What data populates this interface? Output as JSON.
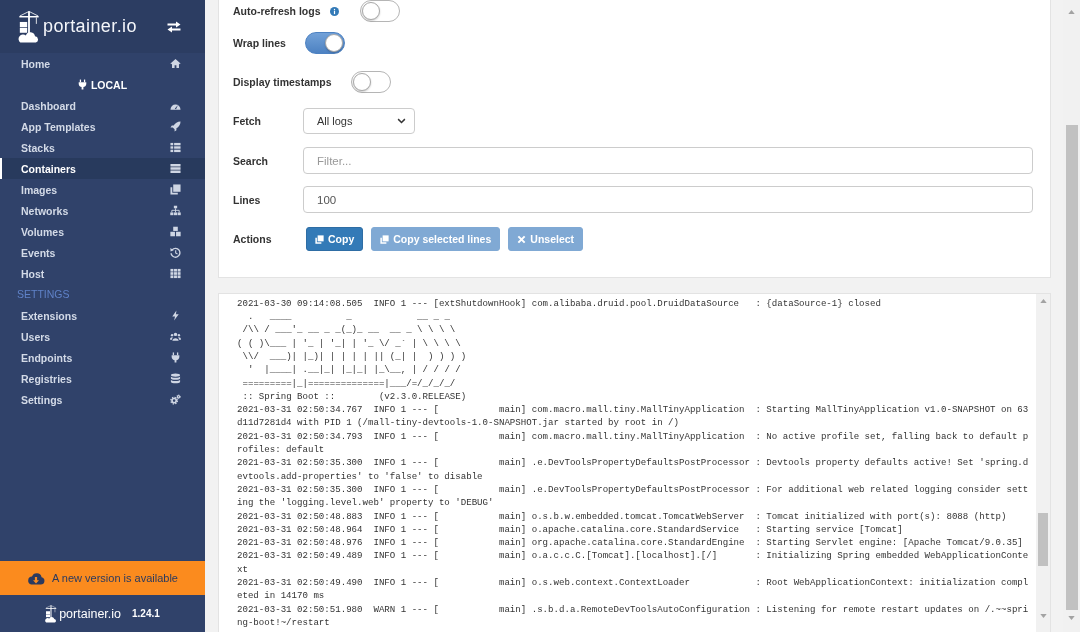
{
  "sidebar": {
    "logo": "portainer.io",
    "items": [
      {
        "label": "Home",
        "selected": false
      }
    ],
    "endpoint": "LOCAL",
    "endpoint_items": [
      {
        "label": "Dashboard",
        "selected": false
      },
      {
        "label": "App Templates",
        "selected": false
      },
      {
        "label": "Stacks",
        "selected": false
      },
      {
        "label": "Containers",
        "selected": true
      },
      {
        "label": "Images",
        "selected": false
      },
      {
        "label": "Networks",
        "selected": false
      },
      {
        "label": "Volumes",
        "selected": false
      },
      {
        "label": "Events",
        "selected": false
      },
      {
        "label": "Host",
        "selected": false
      }
    ],
    "settings_title": "SETTINGS",
    "settings_items": [
      {
        "label": "Extensions",
        "selected": false
      },
      {
        "label": "Users",
        "selected": false
      },
      {
        "label": "Endpoints",
        "selected": false
      },
      {
        "label": "Registries",
        "selected": false
      },
      {
        "label": "Settings",
        "selected": false
      }
    ],
    "update_banner": "A new version is available",
    "footer": {
      "logo": "portainer.io",
      "version": "1.24.1"
    }
  },
  "log_settings": {
    "rows": [
      {
        "kind": "toggle",
        "label": "Auto-refresh logs",
        "info": true,
        "on": false
      },
      {
        "kind": "toggle",
        "label": "Wrap lines",
        "info": false,
        "on": true
      },
      {
        "kind": "toggle",
        "label": "Display timestamps",
        "info": false,
        "on": false
      },
      {
        "kind": "select",
        "label": "Fetch",
        "value": "All logs"
      },
      {
        "kind": "input",
        "label": "Search",
        "placeholder": "Filter..."
      },
      {
        "kind": "input",
        "label": "Lines",
        "value": "100"
      },
      {
        "kind": "actions",
        "label": "Actions",
        "buttons": [
          {
            "label": "Copy",
            "disabled": false
          },
          {
            "label": "Copy selected lines",
            "disabled": true
          },
          {
            "label": "Unselect",
            "disabled": true
          }
        ]
      }
    ]
  },
  "log_output": {
    "lines": [
      "2021-03-30 09:14:08.505  INFO 1 --- [extShutdownHook] com.alibaba.druid.pool.DruidDataSource   : {dataSource-1} closed",
      "  .   ____          _            __ _ _",
      " /\\\\ / ___'_ __ _ _(_)_ __  __ _ \\ \\ \\ \\",
      "( ( )\\___ | '_ | '_| | '_ \\/ _` | \\ \\ \\ \\",
      " \\\\/  ___)| |_)| | | | | || (_| |  ) ) ) )",
      "  '  |____| .__|_| |_|_| |_\\__, | / / / /",
      " =========|_|==============|___/=/_/_/_/",
      " :: Spring Boot ::        (v2.3.0.RELEASE)",
      "2021-03-31 02:50:34.767  INFO 1 --- [           main] com.macro.mall.tiny.MallTinyApplication  : Starting MallTinyApplication v1.0-SNAPSHOT on 63d11d7281d4 with PID 1 (/mall-tiny-devtools-1.0-SNAPSHOT.jar started by root in /)",
      "2021-03-31 02:50:34.793  INFO 1 --- [           main] com.macro.mall.tiny.MallTinyApplication  : No active profile set, falling back to default profiles: default",
      "2021-03-31 02:50:35.300  INFO 1 --- [           main] .e.DevToolsPropertyDefaultsPostProcessor : Devtools property defaults active! Set 'spring.devtools.add-properties' to 'false' to disable",
      "2021-03-31 02:50:35.300  INFO 1 --- [           main] .e.DevToolsPropertyDefaultsPostProcessor : For additional web related logging consider setting the 'logging.level.web' property to 'DEBUG'",
      "2021-03-31 02:50:48.883  INFO 1 --- [           main] o.s.b.w.embedded.tomcat.TomcatWebServer  : Tomcat initialized with port(s): 8088 (http)",
      "2021-03-31 02:50:48.964  INFO 1 --- [           main] o.apache.catalina.core.StandardService   : Starting service [Tomcat]",
      "2021-03-31 02:50:48.976  INFO 1 --- [           main] org.apache.catalina.core.StandardEngine  : Starting Servlet engine: [Apache Tomcat/9.0.35]",
      "2021-03-31 02:50:49.489  INFO 1 --- [           main] o.a.c.c.C.[Tomcat].[localhost].[/]       : Initializing Spring embedded WebApplicationContext",
      "2021-03-31 02:50:49.490  INFO 1 --- [           main] o.s.web.context.ContextLoader            : Root WebApplicationContext: initialization completed in 14170 ms",
      "2021-03-31 02:50:51.980  WARN 1 --- [           main] .s.b.d.a.RemoteDevToolsAutoConfiguration : Listening for remote restart updates on /.~~spring-boot!~/restart"
    ]
  }
}
